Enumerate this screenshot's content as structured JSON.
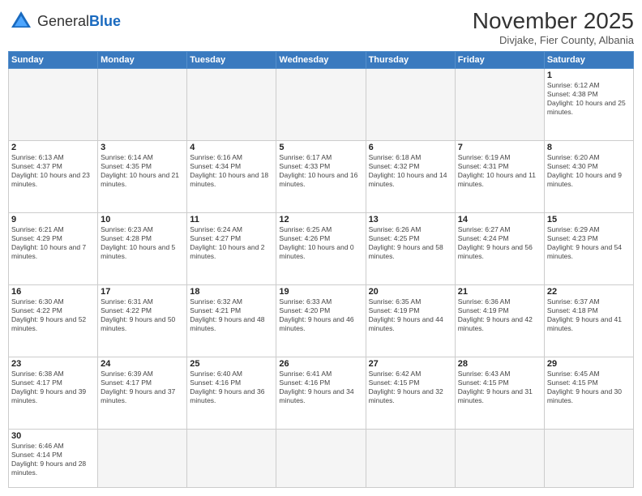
{
  "logo": {
    "general": "General",
    "blue": "Blue"
  },
  "title": "November 2025",
  "location": "Divjake, Fier County, Albania",
  "days_of_week": [
    "Sunday",
    "Monday",
    "Tuesday",
    "Wednesday",
    "Thursday",
    "Friday",
    "Saturday"
  ],
  "weeks": [
    [
      {
        "day": "",
        "info": ""
      },
      {
        "day": "",
        "info": ""
      },
      {
        "day": "",
        "info": ""
      },
      {
        "day": "",
        "info": ""
      },
      {
        "day": "",
        "info": ""
      },
      {
        "day": "",
        "info": ""
      },
      {
        "day": "1",
        "info": "Sunrise: 6:12 AM\nSunset: 4:38 PM\nDaylight: 10 hours and 25 minutes."
      }
    ],
    [
      {
        "day": "2",
        "info": "Sunrise: 6:13 AM\nSunset: 4:37 PM\nDaylight: 10 hours and 23 minutes."
      },
      {
        "day": "3",
        "info": "Sunrise: 6:14 AM\nSunset: 4:35 PM\nDaylight: 10 hours and 21 minutes."
      },
      {
        "day": "4",
        "info": "Sunrise: 6:16 AM\nSunset: 4:34 PM\nDaylight: 10 hours and 18 minutes."
      },
      {
        "day": "5",
        "info": "Sunrise: 6:17 AM\nSunset: 4:33 PM\nDaylight: 10 hours and 16 minutes."
      },
      {
        "day": "6",
        "info": "Sunrise: 6:18 AM\nSunset: 4:32 PM\nDaylight: 10 hours and 14 minutes."
      },
      {
        "day": "7",
        "info": "Sunrise: 6:19 AM\nSunset: 4:31 PM\nDaylight: 10 hours and 11 minutes."
      },
      {
        "day": "8",
        "info": "Sunrise: 6:20 AM\nSunset: 4:30 PM\nDaylight: 10 hours and 9 minutes."
      }
    ],
    [
      {
        "day": "9",
        "info": "Sunrise: 6:21 AM\nSunset: 4:29 PM\nDaylight: 10 hours and 7 minutes."
      },
      {
        "day": "10",
        "info": "Sunrise: 6:23 AM\nSunset: 4:28 PM\nDaylight: 10 hours and 5 minutes."
      },
      {
        "day": "11",
        "info": "Sunrise: 6:24 AM\nSunset: 4:27 PM\nDaylight: 10 hours and 2 minutes."
      },
      {
        "day": "12",
        "info": "Sunrise: 6:25 AM\nSunset: 4:26 PM\nDaylight: 10 hours and 0 minutes."
      },
      {
        "day": "13",
        "info": "Sunrise: 6:26 AM\nSunset: 4:25 PM\nDaylight: 9 hours and 58 minutes."
      },
      {
        "day": "14",
        "info": "Sunrise: 6:27 AM\nSunset: 4:24 PM\nDaylight: 9 hours and 56 minutes."
      },
      {
        "day": "15",
        "info": "Sunrise: 6:29 AM\nSunset: 4:23 PM\nDaylight: 9 hours and 54 minutes."
      }
    ],
    [
      {
        "day": "16",
        "info": "Sunrise: 6:30 AM\nSunset: 4:22 PM\nDaylight: 9 hours and 52 minutes."
      },
      {
        "day": "17",
        "info": "Sunrise: 6:31 AM\nSunset: 4:22 PM\nDaylight: 9 hours and 50 minutes."
      },
      {
        "day": "18",
        "info": "Sunrise: 6:32 AM\nSunset: 4:21 PM\nDaylight: 9 hours and 48 minutes."
      },
      {
        "day": "19",
        "info": "Sunrise: 6:33 AM\nSunset: 4:20 PM\nDaylight: 9 hours and 46 minutes."
      },
      {
        "day": "20",
        "info": "Sunrise: 6:35 AM\nSunset: 4:19 PM\nDaylight: 9 hours and 44 minutes."
      },
      {
        "day": "21",
        "info": "Sunrise: 6:36 AM\nSunset: 4:19 PM\nDaylight: 9 hours and 42 minutes."
      },
      {
        "day": "22",
        "info": "Sunrise: 6:37 AM\nSunset: 4:18 PM\nDaylight: 9 hours and 41 minutes."
      }
    ],
    [
      {
        "day": "23",
        "info": "Sunrise: 6:38 AM\nSunset: 4:17 PM\nDaylight: 9 hours and 39 minutes."
      },
      {
        "day": "24",
        "info": "Sunrise: 6:39 AM\nSunset: 4:17 PM\nDaylight: 9 hours and 37 minutes."
      },
      {
        "day": "25",
        "info": "Sunrise: 6:40 AM\nSunset: 4:16 PM\nDaylight: 9 hours and 36 minutes."
      },
      {
        "day": "26",
        "info": "Sunrise: 6:41 AM\nSunset: 4:16 PM\nDaylight: 9 hours and 34 minutes."
      },
      {
        "day": "27",
        "info": "Sunrise: 6:42 AM\nSunset: 4:15 PM\nDaylight: 9 hours and 32 minutes."
      },
      {
        "day": "28",
        "info": "Sunrise: 6:43 AM\nSunset: 4:15 PM\nDaylight: 9 hours and 31 minutes."
      },
      {
        "day": "29",
        "info": "Sunrise: 6:45 AM\nSunset: 4:15 PM\nDaylight: 9 hours and 30 minutes."
      }
    ],
    [
      {
        "day": "30",
        "info": "Sunrise: 6:46 AM\nSunset: 4:14 PM\nDaylight: 9 hours and 28 minutes."
      },
      {
        "day": "",
        "info": ""
      },
      {
        "day": "",
        "info": ""
      },
      {
        "day": "",
        "info": ""
      },
      {
        "day": "",
        "info": ""
      },
      {
        "day": "",
        "info": ""
      },
      {
        "day": "",
        "info": ""
      }
    ]
  ]
}
